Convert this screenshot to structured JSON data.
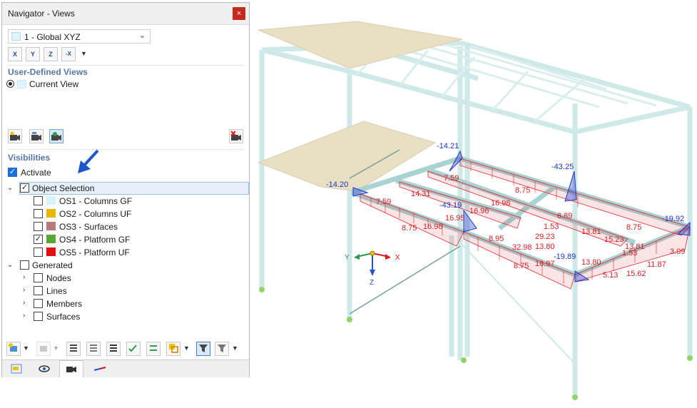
{
  "panel": {
    "title": "Navigator - Views",
    "close_glyph": "×",
    "view_select": {
      "value": "1 - Global XYZ"
    },
    "view_buttons": [
      {
        "icon": "view-x-icon",
        "label": "X"
      },
      {
        "icon": "view-y-icon",
        "label": "Y"
      },
      {
        "icon": "view-z-icon",
        "label": "Z"
      },
      {
        "icon": "view-minus-x-icon",
        "label": "-X"
      }
    ],
    "user_views": {
      "heading": "User-Defined Views",
      "current_view": "Current View"
    },
    "visibilities": {
      "heading": "Visibilities",
      "activate_label": "Activate",
      "activate_checked": true,
      "object_selection": {
        "label": "Object Selection",
        "items": [
          {
            "label": "OS1 - Columns GF",
            "color": "#d6f3fb",
            "checked": false
          },
          {
            "label": "OS2 - Columns UF",
            "color": "#e8b800",
            "checked": false
          },
          {
            "label": "OS3 - Surfaces",
            "color": "#b77a7a",
            "checked": false
          },
          {
            "label": "OS4 - Platform GF",
            "color": "#58a732",
            "checked": true
          },
          {
            "label": "OS5 - Platform UF",
            "color": "#e60f0f",
            "checked": false
          }
        ]
      },
      "generated": {
        "label": "Generated",
        "items": [
          "Nodes",
          "Lines",
          "Members",
          "Surfaces"
        ]
      }
    },
    "bottom_tabs": [
      "data-tab",
      "view-tab",
      "camera-tab",
      "section-tab"
    ]
  },
  "viewport": {
    "axes": {
      "x": "X",
      "y": "Y",
      "z": "Z"
    },
    "colors": {
      "structure": "#cfe9e9",
      "slab": "#e9dfc3",
      "force": "#e0252b",
      "reaction": "#2035c8"
    },
    "reaction_labels": [
      "-14.21",
      "-14.20",
      "-43.25",
      "-43.19",
      "-19.89",
      "-19.92"
    ],
    "force_labels": [
      "7.59",
      "14.31",
      "7.59",
      "16.96",
      "16.98",
      "8.75",
      "16.95",
      "16.98",
      "8.75",
      "6.89",
      "1.53",
      "8.95",
      "29.23",
      "13.81",
      "15.23",
      "8.75",
      "32.98",
      "13.80",
      "13.81",
      "1.53",
      "3.09",
      "8.75",
      "16.97",
      "13.80",
      "11.87",
      "5.13",
      "15.62"
    ]
  }
}
